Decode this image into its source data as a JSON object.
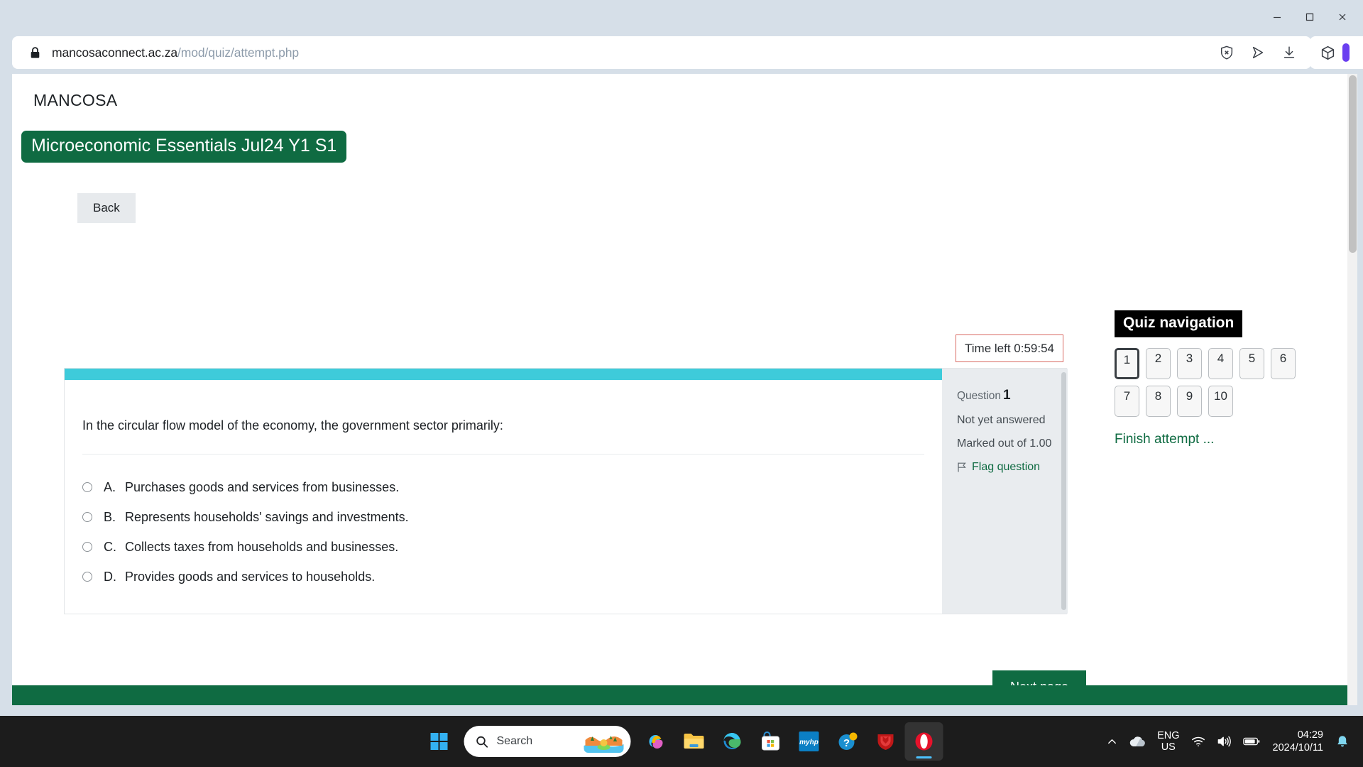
{
  "browser": {
    "url_host": "mancosaconnect.ac.za",
    "url_path": "/mod/quiz/attempt.php",
    "lock_icon": "lock-icon",
    "window_controls": {
      "minimize": "minimize-icon",
      "maximize": "maximize-icon",
      "close": "close-icon"
    },
    "toolbar_icons": [
      "shield-block-icon",
      "send-icon",
      "download-icon",
      "cube-extension-icon"
    ]
  },
  "page": {
    "site_name": "MANCOSA",
    "course_title": "Microeconomic Essentials Jul24 Y1 S1",
    "back_label": "Back",
    "timer_label": "Time left 0:59:54",
    "next_page_label": "Next page",
    "accent_color": "#0f6b42",
    "question_accent_color": "#3ecbda",
    "timer_border_color": "#d96a62"
  },
  "question": {
    "text": "In the circular flow model of the economy, the government sector primarily:",
    "options": [
      {
        "letter": "A.",
        "text": "Purchases goods and services from businesses."
      },
      {
        "letter": "B.",
        "text": "Represents households' savings and investments."
      },
      {
        "letter": "C.",
        "text": "Collects taxes from households and businesses."
      },
      {
        "letter": "D.",
        "text": "Provides goods and services to households."
      }
    ],
    "info": {
      "question_word": "Question",
      "number": "1",
      "state": "Not yet answered",
      "marks": "Marked out of 1.00",
      "flag_label": "Flag question"
    }
  },
  "quiz_nav": {
    "title": "Quiz navigation",
    "buttons": [
      "1",
      "2",
      "3",
      "4",
      "5",
      "6",
      "7",
      "8",
      "9",
      "10"
    ],
    "current_index": 0,
    "finish_label": "Finish attempt ..."
  },
  "taskbar": {
    "start_label": "start-button",
    "search_placeholder": "Search",
    "apps": [
      {
        "name": "copilot",
        "label": "Copilot"
      },
      {
        "name": "file-explorer",
        "label": "File Explorer"
      },
      {
        "name": "microsoft-edge",
        "label": "Microsoft Edge"
      },
      {
        "name": "microsoft-store",
        "label": "Microsoft Store"
      },
      {
        "name": "myhp",
        "label": "myHP"
      },
      {
        "name": "get-help",
        "label": "Get Help"
      },
      {
        "name": "mcafee",
        "label": "McAfee"
      },
      {
        "name": "opera",
        "label": "Opera"
      }
    ],
    "tray": {
      "overflow": "^",
      "onedrive": "onedrive-icon",
      "language_line1": "ENG",
      "language_line2": "US",
      "wifi": "wifi-icon",
      "volume": "volume-icon",
      "battery": "battery-icon",
      "time": "04:29",
      "date": "2024/10/11",
      "notifications": "bell-icon"
    }
  }
}
